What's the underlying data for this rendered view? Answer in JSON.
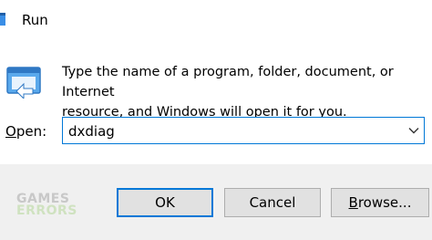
{
  "window": {
    "title": "Run",
    "title_icon": "run-dialog-icon"
  },
  "body": {
    "icon": "run-program-icon",
    "description_line1": "Type the name of a program, folder, document, or Internet",
    "description_line2": "resource, and Windows will open it for you."
  },
  "open": {
    "label_access_key": "O",
    "label_rest": "pen:",
    "value": "dxdiag",
    "dropdown_icon": "chevron-down-icon"
  },
  "buttons": {
    "ok_label": "OK",
    "cancel_label": "Cancel",
    "browse_access_key": "B",
    "browse_rest": "rowse..."
  },
  "watermark": {
    "line1": "GAMES",
    "line2": "ERRORS"
  },
  "colors": {
    "accent": "#0078d7",
    "footer_bg": "#f0f0f0",
    "button_bg": "#e1e1e1"
  }
}
